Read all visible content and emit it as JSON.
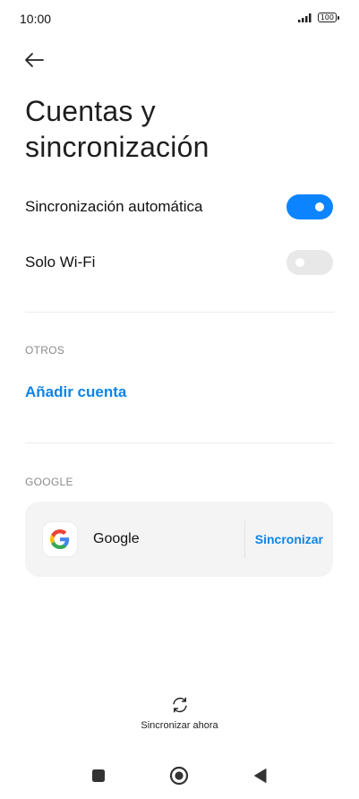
{
  "status_bar": {
    "time": "10:00",
    "battery": "100"
  },
  "page": {
    "title": "Cuentas y sincronización"
  },
  "settings": {
    "auto_sync": {
      "label": "Sincronización automática",
      "enabled": true
    },
    "wifi_only": {
      "label": "Solo Wi-Fi",
      "enabled": false
    }
  },
  "others": {
    "header": "OTROS",
    "add_account": "Añadir cuenta"
  },
  "google": {
    "header": "GOOGLE",
    "account_name": "Google",
    "sync_label": "Sincronizar"
  },
  "bottom": {
    "sync_now_label": "Sincronizar ahora"
  },
  "colors": {
    "accent": "#0d84ff",
    "link": "#0d84e8"
  },
  "icons": {
    "back": "arrow-left-icon",
    "sync": "refresh-icon",
    "nav_recents": "square-icon",
    "nav_home": "circle-icon",
    "nav_back": "triangle-left-icon"
  }
}
